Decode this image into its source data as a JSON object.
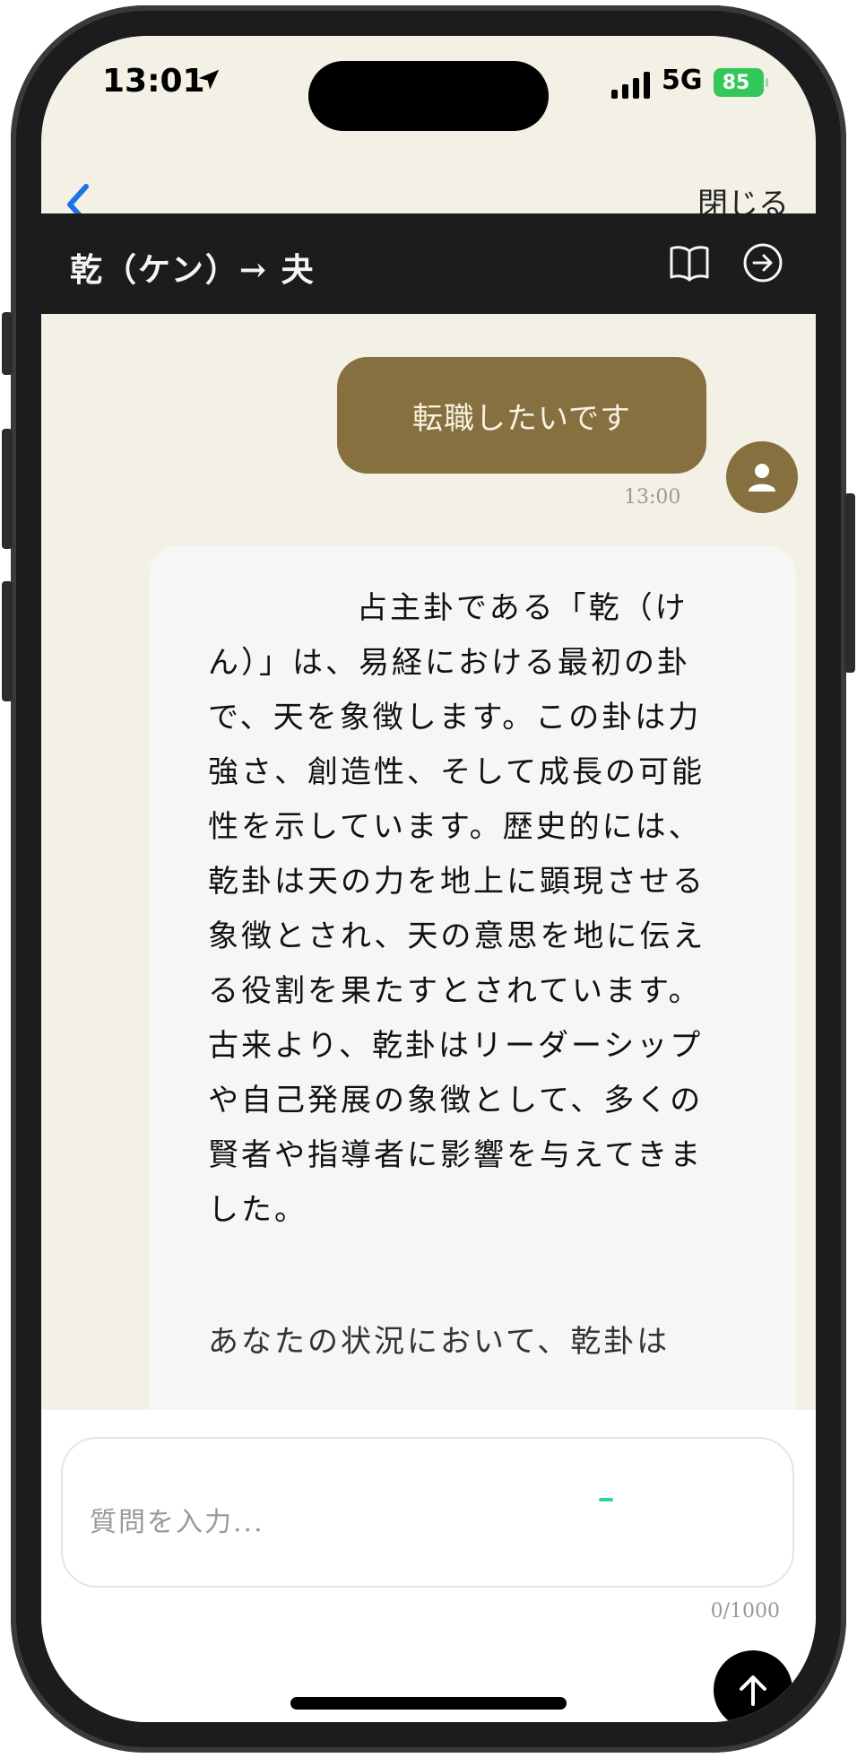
{
  "status_bar": {
    "time": "13:01",
    "network": "5G",
    "battery": "85"
  },
  "nav": {
    "close_label": "閉じる"
  },
  "header": {
    "title": "乾（ケン）→ 夬"
  },
  "chat": {
    "user_message": "転職したいです",
    "user_time": "13:00",
    "ai_message": "占主卦である「乾（けん）」は、易経における最初の卦で、天を象徴します。この卦は力強さ、創造性、そして成長の可能性を示しています。歴史的には、乾卦は天の力を地上に顕現させる象徴とされ、天の意思を地に伝える役割を果たすとされています。古来より、乾卦はリーダーシップや自己発展の象徴として、多くの賢者や指導者に影響を与えてきました。",
    "ai_message_continued": "あなたの状況において、乾卦は"
  },
  "composer": {
    "placeholder": "質問を入力...",
    "char_count": "0/1000"
  },
  "colors": {
    "background": "#f3f0e6",
    "header": "#1c1c1c",
    "accent_brown": "#86703f",
    "battery_green": "#34c759",
    "link_blue": "#1a73e8"
  },
  "icons": [
    "location-arrow-icon",
    "signal-icon",
    "battery-icon",
    "back-chevron-icon",
    "book-icon",
    "arrow-right-circle-icon",
    "person-icon",
    "arrow-up-icon"
  ]
}
